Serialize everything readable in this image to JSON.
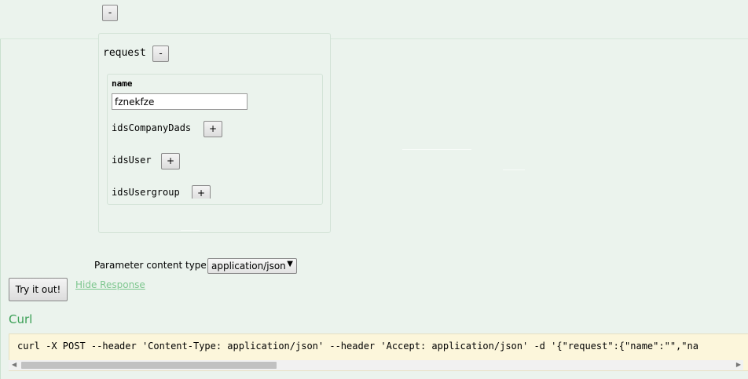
{
  "top_collapse_button": "-",
  "request": {
    "label": "request",
    "collapse_button": "-",
    "fields": {
      "name_label": "name",
      "name_value": "fznekfze",
      "ids_company_dads_label": "idsCompanyDads",
      "ids_user_label": "idsUser",
      "ids_usergroup_label": "idsUsergroup",
      "add_button": "+"
    }
  },
  "parameter_content_type": {
    "label": "Parameter content type:",
    "selected": "application/json"
  },
  "try_button": "Try it out!",
  "hide_response_link": "Hide Response",
  "curl": {
    "title": "Curl",
    "command": "curl -X POST --header 'Content-Type: application/json' --header 'Accept: application/json' -d '{\"request\":{\"name\":\"\",\"na"
  }
}
